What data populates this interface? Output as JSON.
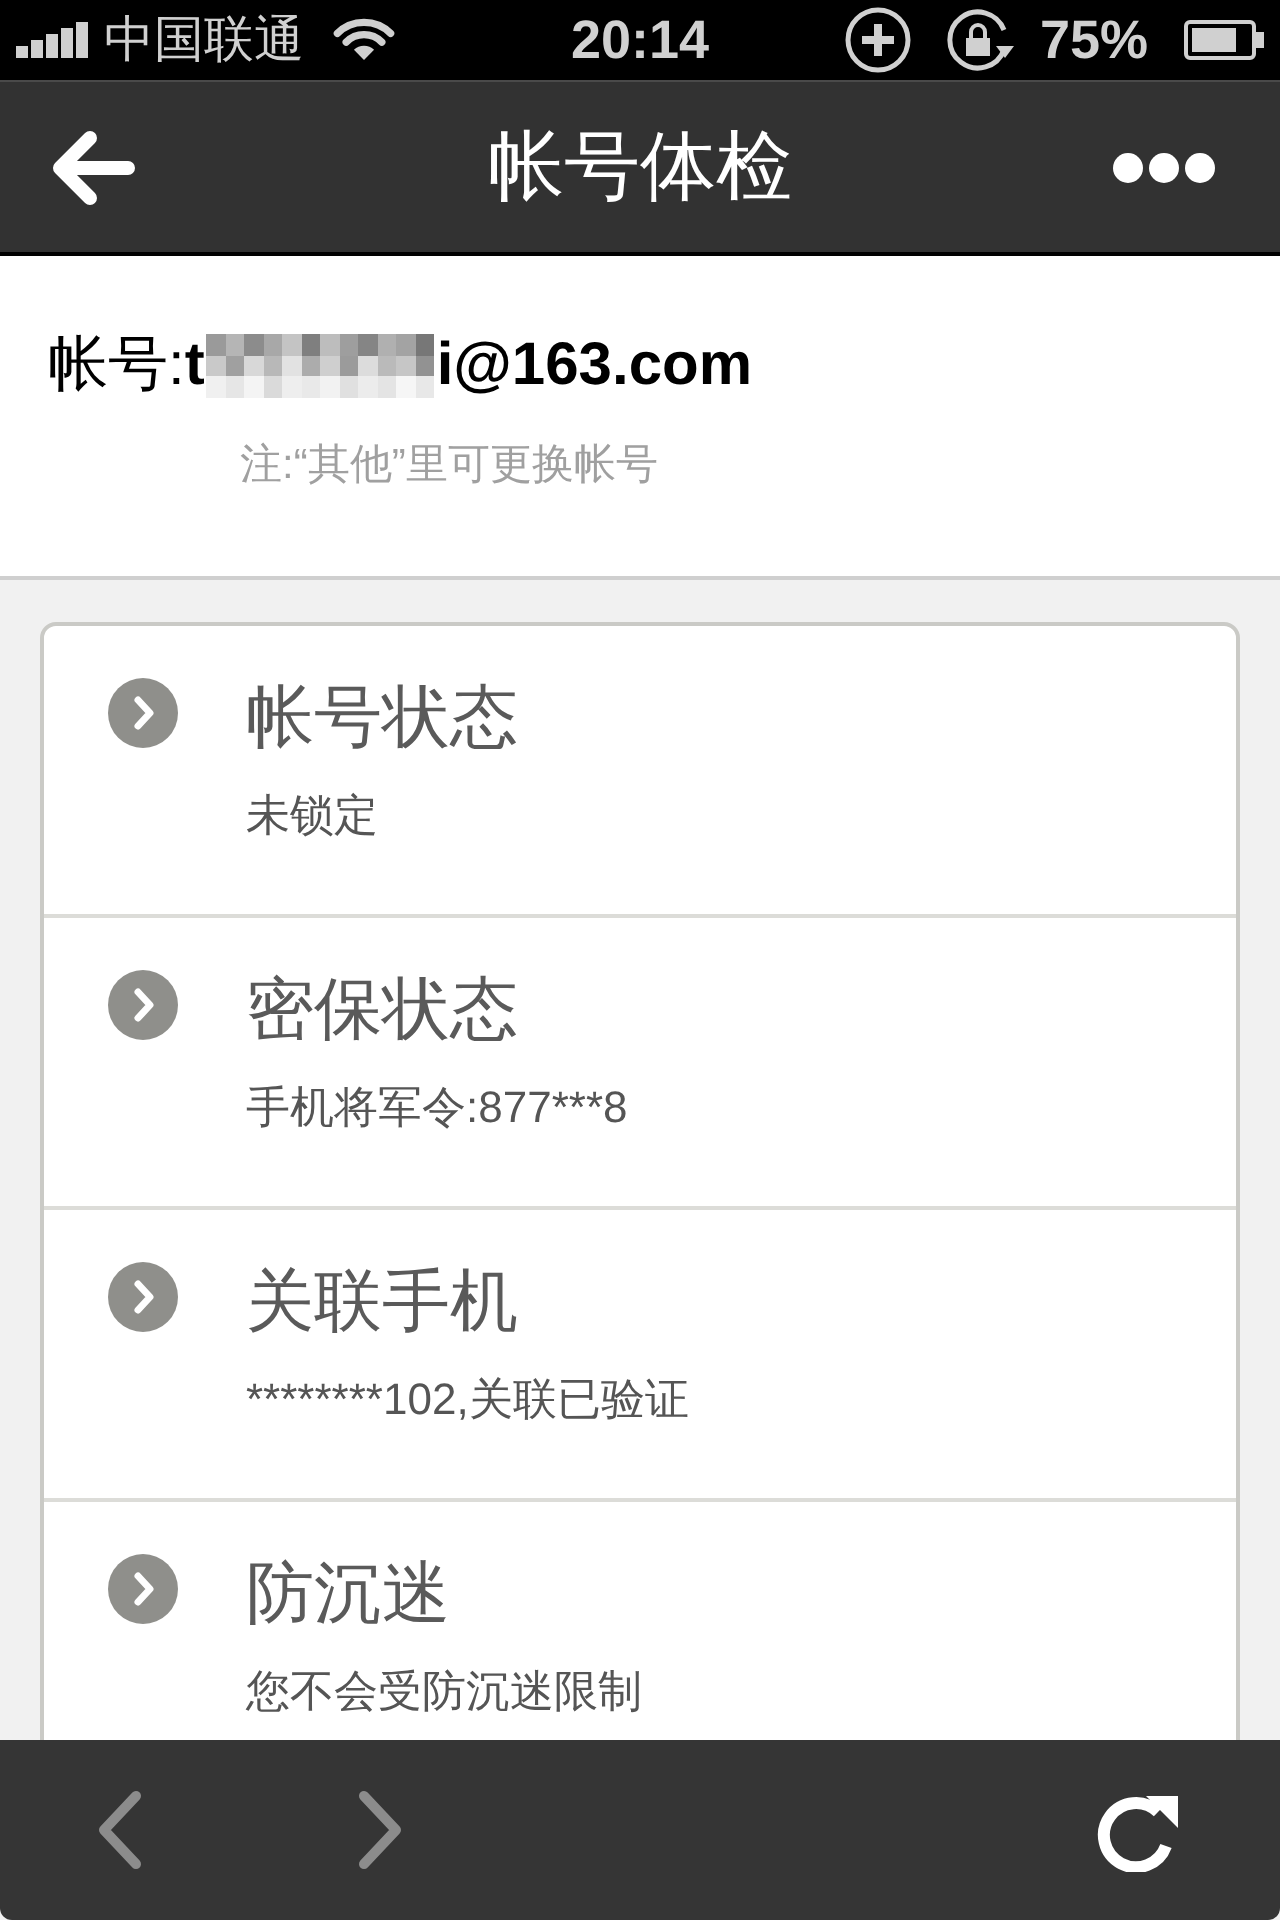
{
  "status_bar": {
    "carrier": "中国联通",
    "time": "20:14",
    "battery": "75%"
  },
  "nav_bar": {
    "title": "帐号体检"
  },
  "account": {
    "label": "帐号:",
    "value_start": "t",
    "redacted": true,
    "value_end": "i@163.com",
    "note": "注:“其他”里可更换帐号"
  },
  "items": [
    {
      "title": "帐号状态",
      "detail": "未锁定"
    },
    {
      "title": "密保状态",
      "detail": "手机将军令:877***8"
    },
    {
      "title": "关联手机",
      "detail": "********102,关联已验证"
    },
    {
      "title": "防沉迷",
      "detail": "您不会受防沉迷限制"
    }
  ],
  "toolbar": [
    {
      "kind": "back",
      "disabled": true
    },
    {
      "kind": "forward",
      "disabled": true
    },
    {
      "kind": "reload",
      "disabled": false
    }
  ]
}
